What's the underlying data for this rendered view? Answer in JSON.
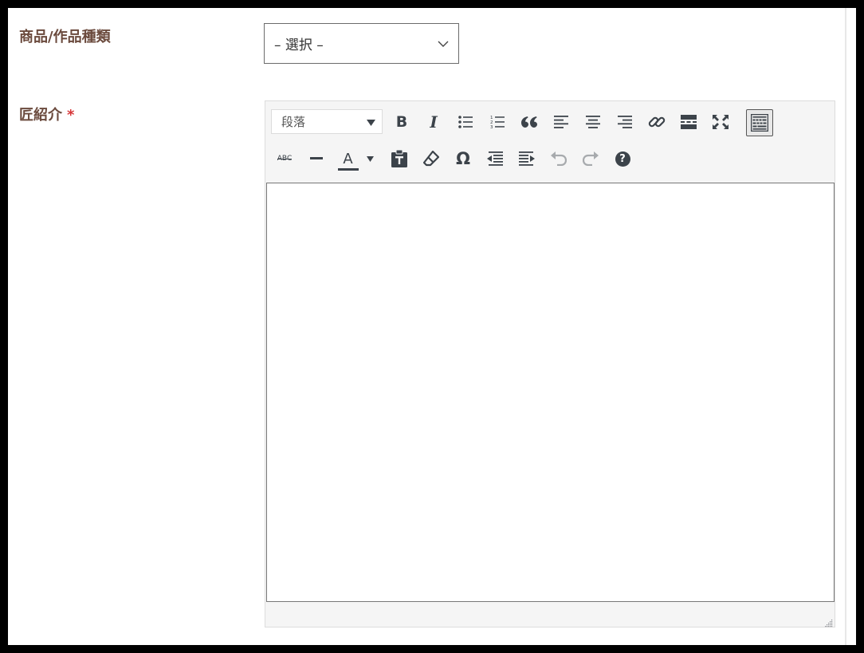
{
  "fields": {
    "product_type": {
      "label": "商品/作品種類",
      "selected": "– 選択 –"
    },
    "artisan_intro": {
      "label": "匠紹介",
      "required_mark": "*"
    }
  },
  "editor": {
    "format_selected": "段落",
    "toolbar_row1": [
      "bold-icon",
      "italic-icon",
      "bullet-list-icon",
      "numbered-list-icon",
      "blockquote-icon",
      "align-left-icon",
      "align-center-icon",
      "align-right-icon",
      "link-icon",
      "read-more-icon",
      "fullscreen-icon",
      "toolbar-toggle-icon"
    ],
    "toolbar_row2": [
      "strikethrough-icon",
      "horizontal-line-icon",
      "text-color-icon",
      "paste-text-icon",
      "clear-formatting-icon",
      "special-character-icon",
      "outdent-icon",
      "indent-icon",
      "undo-icon",
      "redo-icon",
      "help-icon"
    ],
    "glyphs": {
      "bold": "B",
      "italic": "I",
      "abc": "ABC",
      "text_color": "A",
      "omega": "Ω",
      "help": "?"
    },
    "colors": {
      "icon": "#3c434a",
      "icon_disabled": "#a7aaad",
      "label": "#6b4a3d",
      "required": "#d63638"
    }
  }
}
